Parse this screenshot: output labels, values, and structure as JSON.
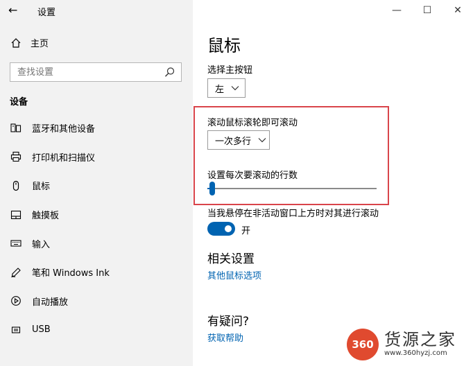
{
  "window": {
    "app_title": "设置",
    "back_icon": "←",
    "minimize_icon": "—",
    "maximize_icon": "☐",
    "close_icon": "✕"
  },
  "sidebar": {
    "home_label": "主页",
    "search_placeholder": "查找设置",
    "section_label": "设备",
    "items": [
      {
        "label": "蓝牙和其他设备",
        "icon": "bluetooth-devices-icon"
      },
      {
        "label": "打印机和扫描仪",
        "icon": "printer-icon"
      },
      {
        "label": "鼠标",
        "icon": "mouse-icon",
        "selected": true
      },
      {
        "label": "触摸板",
        "icon": "touchpad-icon"
      },
      {
        "label": "输入",
        "icon": "keyboard-icon"
      },
      {
        "label": "笔和 Windows Ink",
        "icon": "pen-icon"
      },
      {
        "label": "自动播放",
        "icon": "autoplay-icon"
      },
      {
        "label": "USB",
        "icon": "usb-icon"
      }
    ]
  },
  "main": {
    "page_title": "鼠标",
    "primary_button": {
      "label": "选择主按钮",
      "value": "左"
    },
    "scroll_mode": {
      "label": "滚动鼠标滚轮即可滚动",
      "value": "一次多行"
    },
    "scroll_lines": {
      "label": "设置每次要滚动的行数",
      "value_fraction": 0.03
    },
    "inactive_scroll": {
      "label": "当我悬停在非活动窗口上方时对其进行滚动",
      "state_label": "开",
      "on": true
    },
    "related": {
      "heading": "相关设置",
      "link": "其他鼠标选项"
    },
    "help": {
      "heading": "有疑问?",
      "link": "获取帮助"
    }
  },
  "watermark": {
    "logo_text": "360",
    "name": "货源之家",
    "url": "www.360hyzj.com"
  },
  "colors": {
    "accent": "#0063b1",
    "highlight_border": "#d9444a",
    "sidebar_bg": "#f2f2f2"
  }
}
